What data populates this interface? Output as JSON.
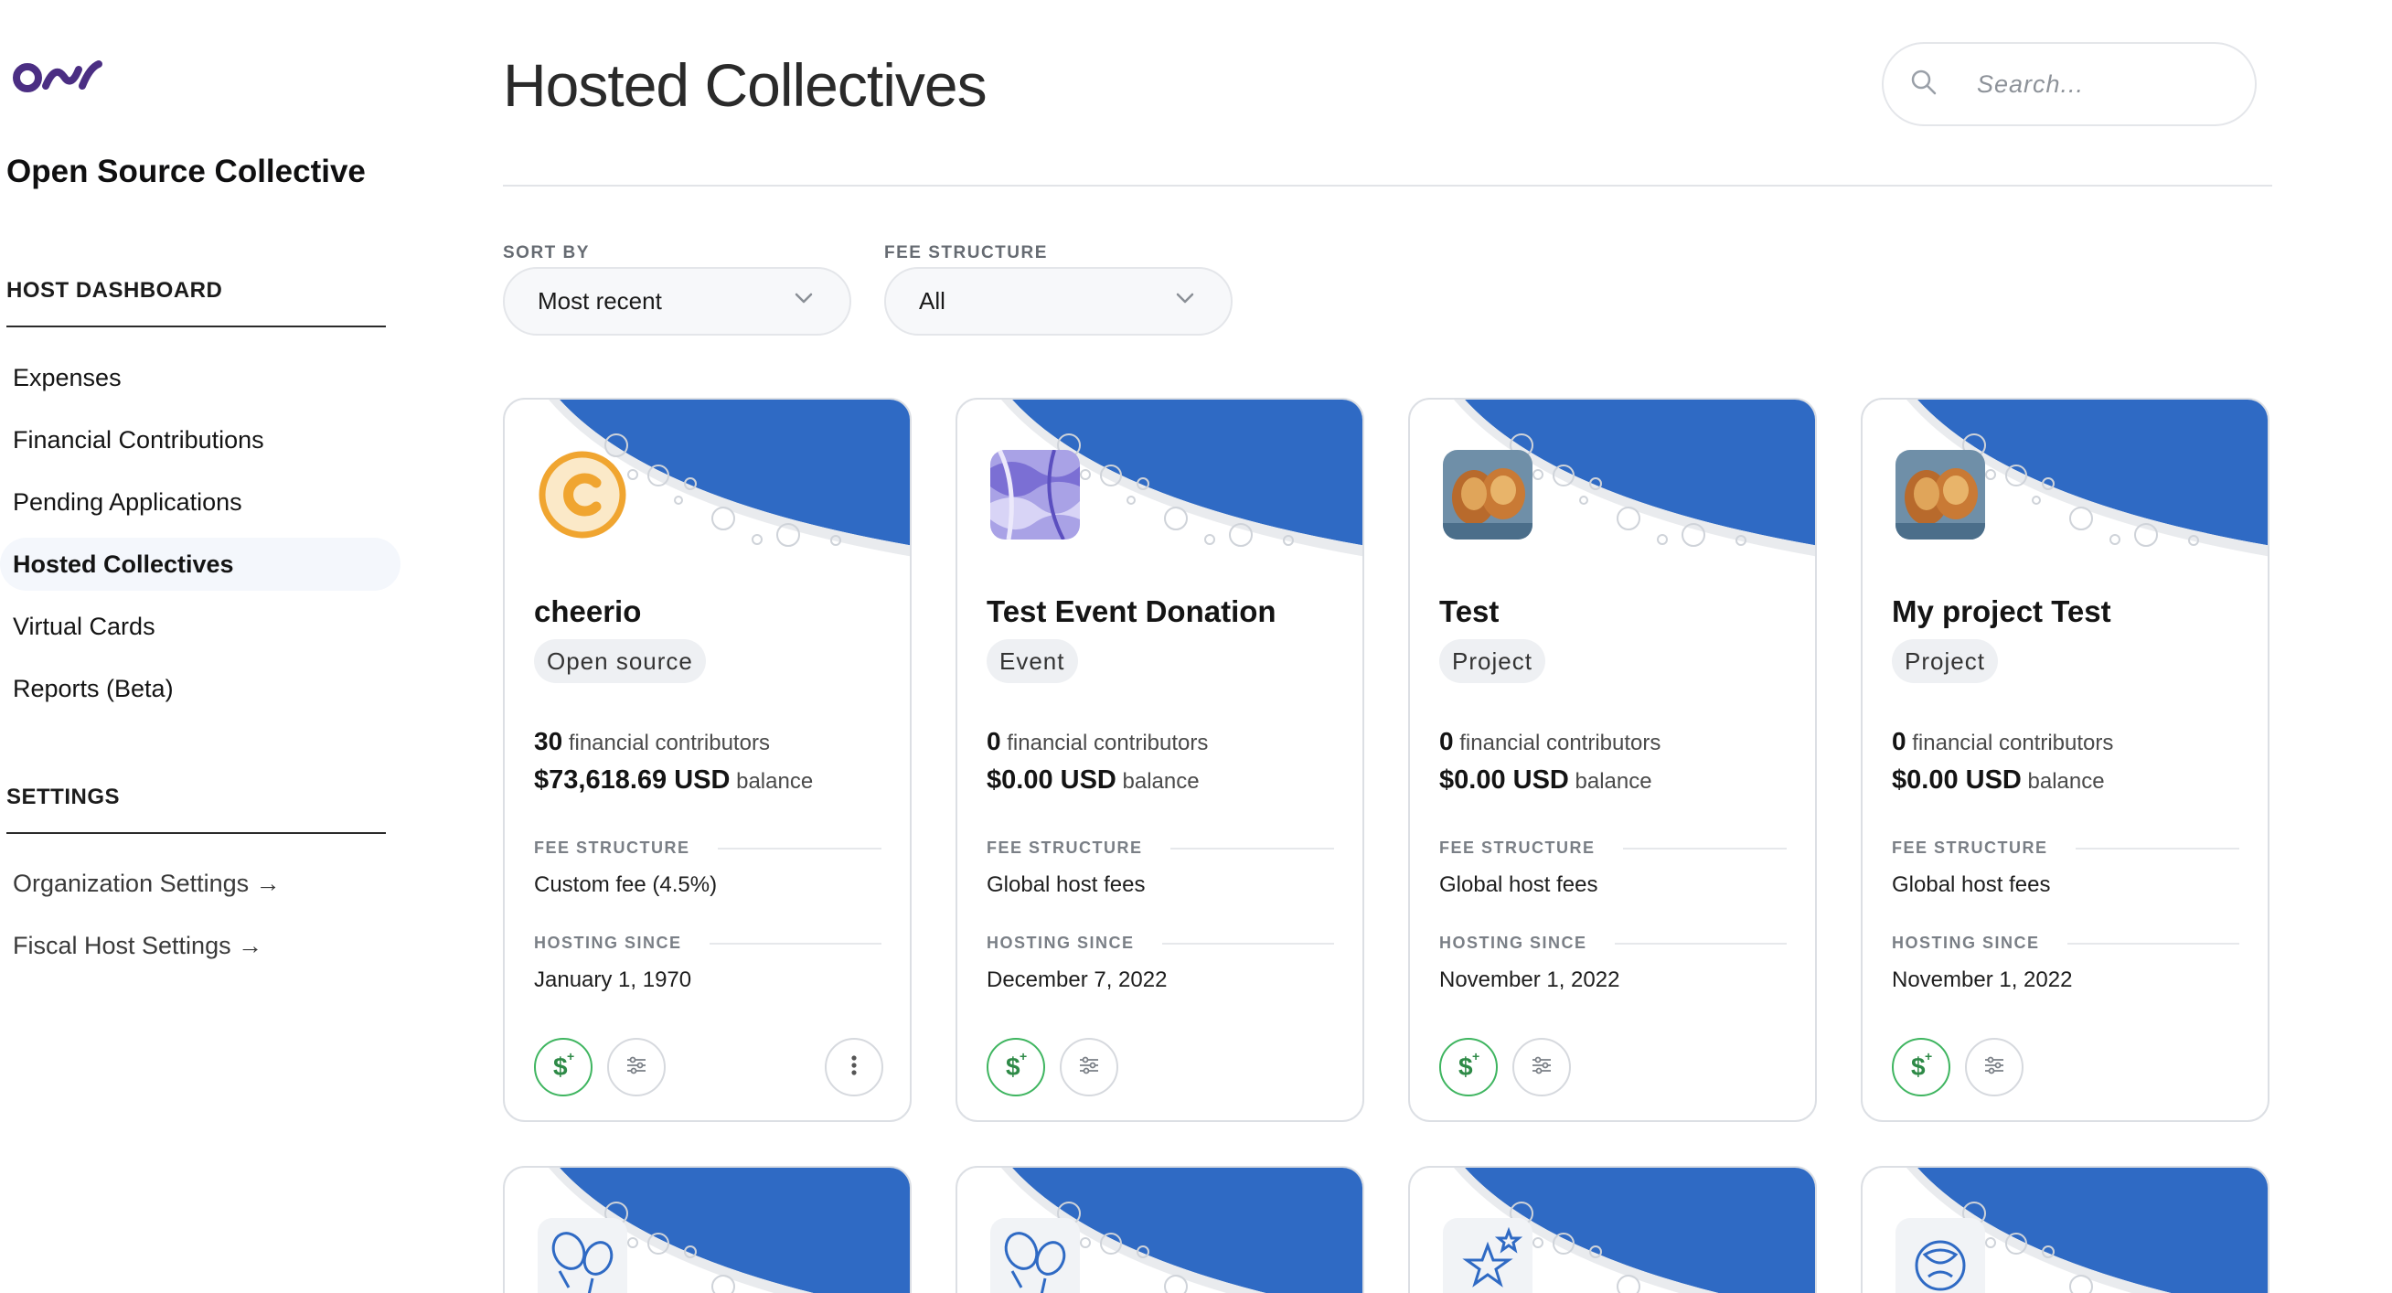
{
  "sidebar": {
    "org_name": "Open Source Collective",
    "host_section": "HOST DASHBOARD",
    "host_items": [
      "Expenses",
      "Financial Contributions",
      "Pending Applications",
      "Hosted Collectives",
      "Virtual Cards",
      "Reports (Beta)"
    ],
    "active_item": "Hosted Collectives",
    "settings_section": "SETTINGS",
    "settings_items": [
      "Organization Settings →",
      "Fiscal Host Settings →"
    ]
  },
  "header": {
    "title": "Hosted Collectives",
    "search_placeholder": "Search..."
  },
  "filters": {
    "sort_label": "SORT BY",
    "sort_value": "Most recent",
    "fee_label": "FEE STRUCTURE",
    "fee_value": "All"
  },
  "labels": {
    "contributors_suffix": "financial contributors",
    "balance_suffix": "balance",
    "fee_structure": "FEE STRUCTURE",
    "hosting_since": "HOSTING SINCE"
  },
  "colors": {
    "brand_blue": "#2f6ac4",
    "accent_green": "#3fb560",
    "logo_purple": "#4b2e83"
  },
  "cards": [
    {
      "name": "cheerio",
      "type": "Open source",
      "contributors": "30",
      "balance": "$73,618.69 USD",
      "fee_structure": "Custom fee (4.5%)",
      "hosting_since": "January 1, 1970",
      "avatar": "letter-c-icon",
      "has_more_menu": true
    },
    {
      "name": "Test Event Donation",
      "type": "Event",
      "contributors": "0",
      "balance": "$0.00 USD",
      "fee_structure": "Global host fees",
      "hosting_since": "December 7, 2022",
      "avatar": "marble-image-icon",
      "has_more_menu": false
    },
    {
      "name": "Test",
      "type": "Project",
      "contributors": "0",
      "balance": "$0.00 USD",
      "fee_structure": "Global host fees",
      "hosting_since": "November 1, 2022",
      "avatar": "food-image-icon",
      "has_more_menu": false
    },
    {
      "name": "My project Test",
      "type": "Project",
      "contributors": "0",
      "balance": "$0.00 USD",
      "fee_structure": "Global host fees",
      "hosting_since": "November 1, 2022",
      "avatar": "food-image-icon",
      "has_more_menu": false
    }
  ],
  "cards_row2_avatars": [
    "lightbulbs-icon",
    "lightbulbs-icon",
    "stars-icon",
    "leaves-icon"
  ]
}
